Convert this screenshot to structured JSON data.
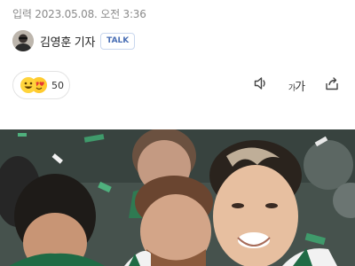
{
  "article": {
    "timestamp": "입력 2023.05.08. 오전 3:36"
  },
  "byline": {
    "author": "김영훈 기자",
    "talk_badge": "TALK"
  },
  "reactions": {
    "emojis": [
      "smile-emoji",
      "heart-eyes-emoji"
    ],
    "count": "50"
  },
  "toolbar": {
    "speaker_icon": "speaker-icon",
    "font_size_small": "가",
    "font_size_large": "가",
    "share_icon": "share-icon"
  },
  "colors": {
    "talk_badge_text": "#4a6fb5",
    "meta_text": "#8a8a8a",
    "emoji_yellow": "#ffd43b"
  }
}
